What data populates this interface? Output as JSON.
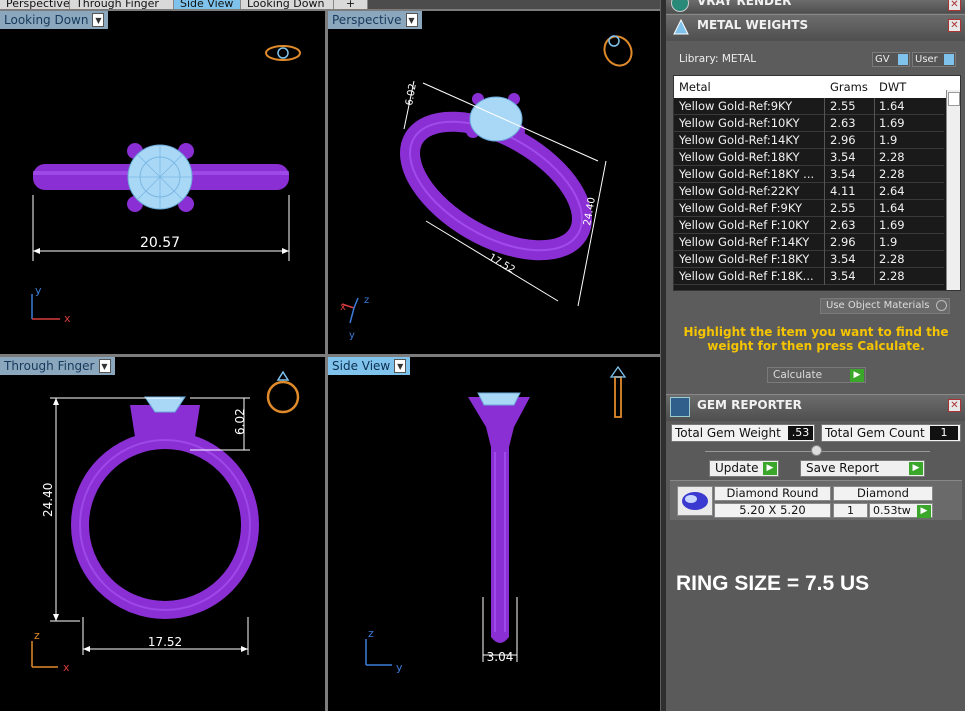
{
  "tabs": [
    {
      "label": "Perspective",
      "active": false
    },
    {
      "label": "Through Finger",
      "active": false
    },
    {
      "label": "Side View",
      "active": true
    },
    {
      "label": "Looking Down",
      "active": false
    },
    {
      "label": "+",
      "active": false
    }
  ],
  "viewports": {
    "top_left": {
      "label": "Looking Down",
      "dimension": "20.57",
      "axis_y": "y",
      "axis_x": "x"
    },
    "top_right": {
      "label": "Perspective",
      "dim_a": "6.02",
      "dim_b": "24.40",
      "dim_c": "17.52",
      "axis_x": "x",
      "axis_y": "y",
      "axis_z": "z"
    },
    "bottom_left": {
      "label": "Through Finger",
      "dim_height": "24.40",
      "dim_top": "6.02",
      "dim_width": "17.52",
      "axis_z": "z",
      "axis_x": "x"
    },
    "bottom_right": {
      "label": "Side View",
      "dim_width": "3.04",
      "axis_z": "z",
      "axis_y": "y"
    }
  },
  "vray_panel": {
    "title": "VRAY RENDER"
  },
  "metal_weights": {
    "title": "METAL WEIGHTS",
    "library_label": "Library: METAL",
    "gv_label": "GV",
    "user_label": "User",
    "columns": [
      "Metal",
      "Grams",
      "DWT"
    ],
    "rows": [
      [
        "Yellow Gold-Ref:9KY",
        "2.55",
        "1.64"
      ],
      [
        "Yellow Gold-Ref:10KY",
        "2.63",
        "1.69"
      ],
      [
        "Yellow Gold-Ref:14KY",
        "2.96",
        "1.9"
      ],
      [
        "Yellow Gold-Ref:18KY",
        "3.54",
        "2.28"
      ],
      [
        "Yellow Gold-Ref:18KY ...",
        "3.54",
        "2.28"
      ],
      [
        "Yellow Gold-Ref:22KY",
        "4.11",
        "2.64"
      ],
      [
        "Yellow Gold-Ref F:9KY",
        "2.55",
        "1.64"
      ],
      [
        "Yellow Gold-Ref F:10KY",
        "2.63",
        "1.69"
      ],
      [
        "Yellow Gold-Ref F:14KY",
        "2.96",
        "1.9"
      ],
      [
        "Yellow Gold-Ref F:18KY",
        "3.54",
        "2.28"
      ],
      [
        "Yellow Gold-Ref F:18K...",
        "3.54",
        "2.28"
      ]
    ],
    "use_object_materials": "Use Object Materials",
    "instruction": "Highlight the item you want to find the weight for then press Calculate.",
    "calculate_label": "Calculate"
  },
  "gem_reporter": {
    "title": "GEM REPORTER",
    "total_weight_label": "Total Gem Weight",
    "total_weight_value": ".53",
    "total_count_label": "Total Gem Count",
    "total_count_value": "1",
    "update_label": "Update",
    "save_report_label": "Save Report",
    "gem": {
      "shape": "Diamond Round",
      "size": "5.20 X 5.20",
      "type": "Diamond",
      "count": "1",
      "weight": "0.53tw"
    }
  },
  "ring_size_text": "RING SIZE = 7.5 US",
  "colors": {
    "ring": "#8a2fd4",
    "stone": "#a9d8f7",
    "accent": "#7fc3ec",
    "instruction": "#f5c400",
    "dim_line": "#ffffff"
  }
}
